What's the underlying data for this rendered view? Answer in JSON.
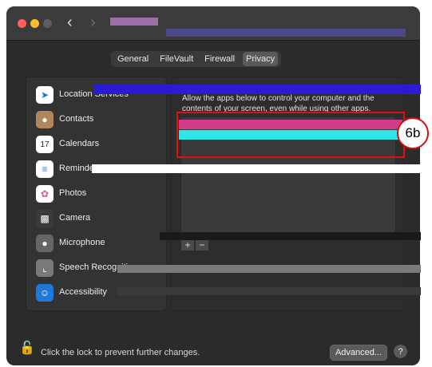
{
  "tabs": [
    {
      "label": "General"
    },
    {
      "label": "FileVault"
    },
    {
      "label": "Firewall"
    },
    {
      "label": "Privacy"
    }
  ],
  "sidebar": {
    "items": [
      {
        "label": "Location Services",
        "icon": "location-arrow-icon",
        "color": "#1a73e8"
      },
      {
        "label": "Contacts",
        "icon": "contacts-book-icon",
        "color": "#b0875a"
      },
      {
        "label": "Calendars",
        "icon": "calendar-icon",
        "color": "#ffffff"
      },
      {
        "label": "Reminders",
        "icon": "reminders-list-icon",
        "color": "#ffffff"
      },
      {
        "label": "Photos",
        "icon": "photos-flower-icon",
        "color": "#f2a93b"
      },
      {
        "label": "Camera",
        "icon": "camera-icon",
        "color": "#3a3a3a"
      },
      {
        "label": "Microphone",
        "icon": "microphone-icon",
        "color": "#666666"
      },
      {
        "label": "Speech Recognition",
        "icon": "speech-waveform-icon",
        "color": "#7a7a7a"
      },
      {
        "label": "Accessibility",
        "icon": "accessibility-person-icon",
        "color": "#1e7ad8"
      }
    ]
  },
  "main": {
    "description": "Allow the apps below to control your computer and the contents of your screen, even while using other apps."
  },
  "callout": {
    "label": "6b"
  },
  "footer": {
    "lock_text": "Click the lock to prevent further changes.",
    "advanced_label": "Advanced...",
    "help_label": "?"
  },
  "colors": {
    "highlight": "#e01010",
    "window_bg": "#2b2b2b"
  }
}
